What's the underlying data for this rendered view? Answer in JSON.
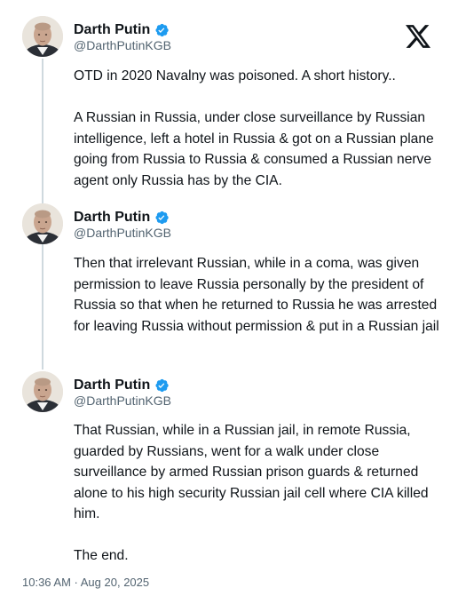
{
  "brand_logo_icon": "x-logo-icon",
  "colors": {
    "verified": "#1d9bf0",
    "handle": "#536471",
    "text": "#0f1419",
    "thread_line": "#cfd9de"
  },
  "posts": [
    {
      "author_name": "Darth Putin",
      "handle": "@DarthPutinKGB",
      "text": "OTD in 2020 Navalny was poisoned. A short history..\n\nA Russian in Russia, under close surveillance by Russian intelligence, left a hotel in Russia & got on a Russian plane going from Russia to Russia & consumed a Russian nerve agent only Russia has by the CIA."
    },
    {
      "author_name": "Darth Putin",
      "handle": "@DarthPutinKGB",
      "text": "Then that irrelevant Russian, while in a coma, was given permission to leave Russia personally by the president of Russia so that when he returned to Russia he was arrested for leaving Russia without permission & put in a Russian jail"
    },
    {
      "author_name": "Darth Putin",
      "handle": "@DarthPutinKGB",
      "text": "That Russian, while in a Russian jail, in remote Russia, guarded by Russians, went for a walk under close surveillance by armed Russian prison guards & returned alone to his high security Russian jail cell where CIA killed him.\n\nThe end."
    }
  ],
  "timestamp": "10:36 AM · Aug 20, 2025"
}
